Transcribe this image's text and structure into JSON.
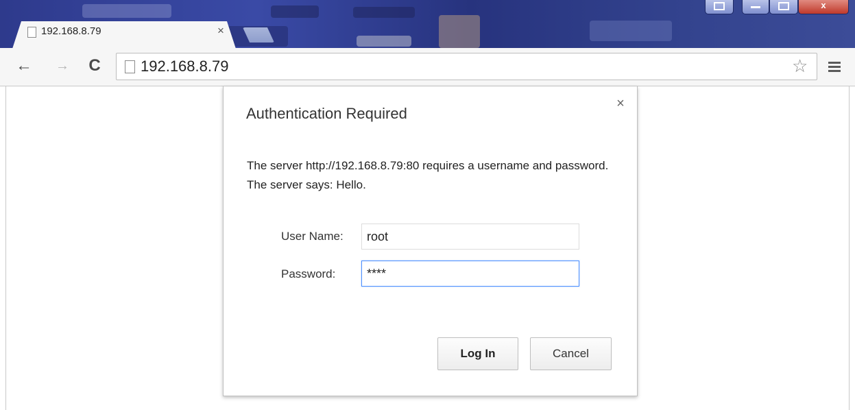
{
  "tab": {
    "title": "192.168.8.79",
    "close_glyph": "×",
    "favicon": "page-icon"
  },
  "toolbar": {
    "back_glyph": "←",
    "forward_glyph": "→",
    "reload_glyph": "C",
    "url": "192.168.8.79",
    "star_glyph": "☆",
    "menu_icon": "hamburger-menu-icon"
  },
  "window_controls": {
    "restore": "restore-icon",
    "minimize": "minimize-icon",
    "maximize": "maximize-icon",
    "close_glyph": "x"
  },
  "dialog": {
    "title": "Authentication Required",
    "close_glyph": "×",
    "message": "The server http://192.168.8.79:80 requires a username and password. The server says: Hello.",
    "username_label": "User Name:",
    "username_value": "root",
    "password_label": "Password:",
    "password_value": "****",
    "login_label": "Log In",
    "cancel_label": "Cancel"
  },
  "colors": {
    "title_bar": "#33418f",
    "focus_border": "#4d90fe",
    "close_button": "#c0392b"
  }
}
